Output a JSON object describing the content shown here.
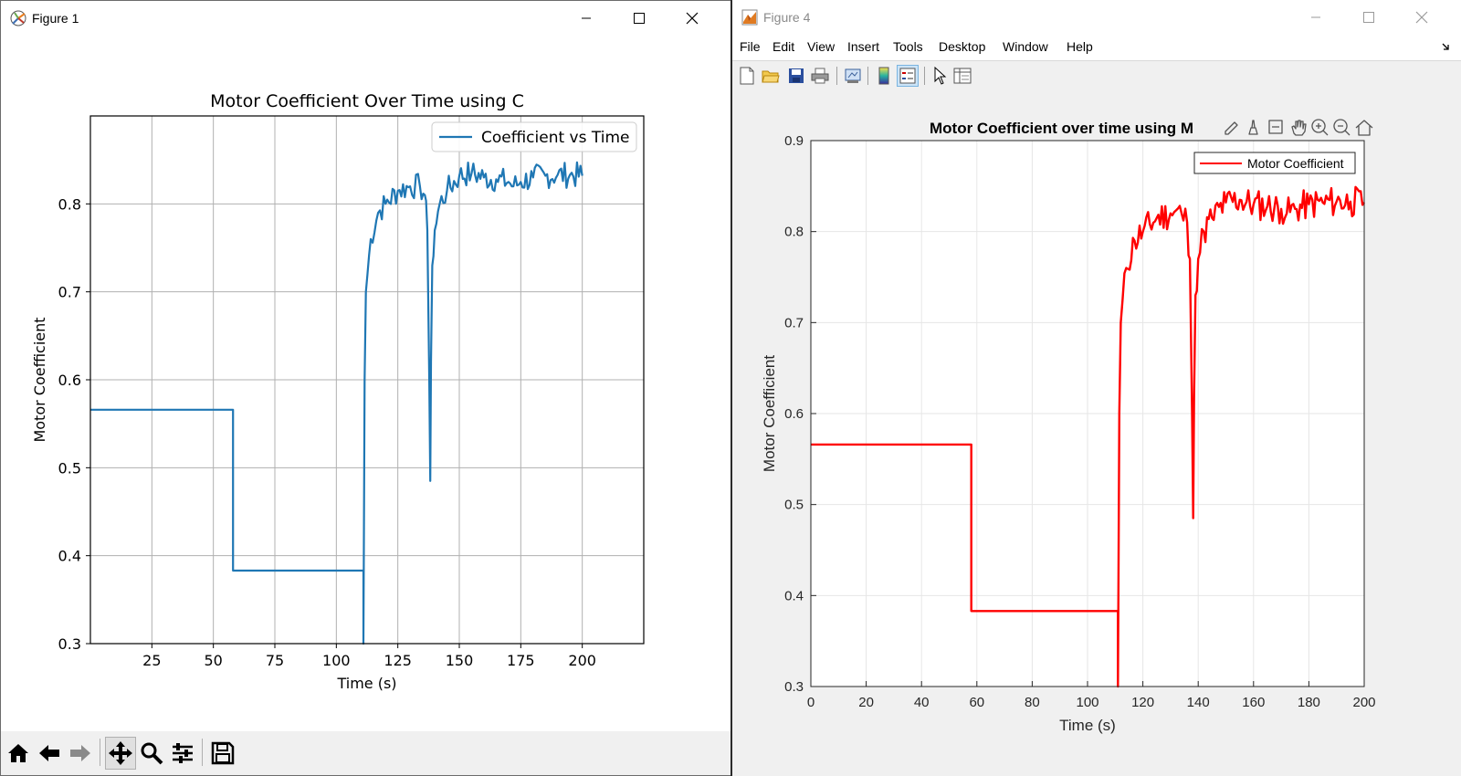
{
  "window1": {
    "title": "Figure 1",
    "chart_data": {
      "type": "line",
      "title": "Motor Coefficient Over Time using C",
      "xlabel": "Time (s)",
      "ylabel": "Motor Coefficient",
      "xlim": [
        0,
        225
      ],
      "ylim": [
        0.3,
        0.9
      ],
      "xticks": [
        25,
        50,
        75,
        100,
        125,
        150,
        175,
        200
      ],
      "yticks": [
        0.3,
        0.4,
        0.5,
        0.6,
        0.7,
        0.8
      ],
      "grid": true,
      "legend_position": "upper-right",
      "series": [
        {
          "name": "Coefficient vs Time",
          "color": "#1f77b4",
          "x": [
            0,
            58,
            58,
            111,
            111,
            111.5,
            112,
            114,
            117,
            120,
            125,
            130,
            134,
            136,
            137,
            137.8,
            138.2,
            138.5,
            139,
            140,
            142,
            145,
            150,
            155,
            160,
            165,
            170,
            172,
            175,
            180,
            185,
            190,
            195,
            200
          ],
          "y": [
            0.566,
            0.566,
            0.383,
            0.383,
            0.3,
            0.6,
            0.7,
            0.76,
            0.79,
            0.8,
            0.815,
            0.82,
            0.82,
            0.81,
            0.77,
            0.6,
            0.485,
            0.62,
            0.73,
            0.77,
            0.8,
            0.815,
            0.832,
            0.835,
            0.83,
            0.828,
            0.825,
            0.82,
            0.825,
            0.83,
            0.832,
            0.833,
            0.833,
            0.832
          ]
        }
      ]
    },
    "toolbar_buttons": [
      "home-icon",
      "back-icon",
      "forward-icon",
      "pan-icon",
      "zoom-icon",
      "configure-icon",
      "save-icon"
    ]
  },
  "window2": {
    "title": "Figure 4",
    "menu": [
      "File",
      "Edit",
      "View",
      "Insert",
      "Tools",
      "Desktop",
      "Window",
      "Help"
    ],
    "chart_data": {
      "type": "line",
      "title": "Motor Coefficient over time using M",
      "xlabel": "Time (s)",
      "ylabel": "Motor Coefficient",
      "xlim": [
        0,
        200
      ],
      "ylim": [
        0.3,
        0.9
      ],
      "xticks": [
        0,
        20,
        40,
        60,
        80,
        100,
        120,
        140,
        160,
        180,
        200
      ],
      "yticks": [
        0.3,
        0.4,
        0.5,
        0.6,
        0.7,
        0.8,
        0.9
      ],
      "grid": true,
      "legend_position": "upper-right",
      "series": [
        {
          "name": "Motor Coefficient",
          "color": "#ff0000",
          "x": [
            0,
            58,
            58,
            111,
            111,
            111.5,
            112,
            114,
            117,
            120,
            125,
            130,
            134,
            136,
            137,
            137.8,
            138.2,
            138.5,
            139,
            140,
            142,
            145,
            150,
            155,
            160,
            165,
            170,
            172,
            175,
            180,
            185,
            190,
            195,
            200
          ],
          "y": [
            0.566,
            0.566,
            0.383,
            0.383,
            0.3,
            0.6,
            0.7,
            0.76,
            0.79,
            0.8,
            0.815,
            0.82,
            0.82,
            0.81,
            0.77,
            0.6,
            0.485,
            0.62,
            0.73,
            0.77,
            0.8,
            0.815,
            0.832,
            0.835,
            0.83,
            0.828,
            0.825,
            0.82,
            0.825,
            0.83,
            0.832,
            0.833,
            0.833,
            0.832
          ]
        }
      ]
    }
  },
  "colors": {
    "mpl_line": "#1f77b4",
    "matlab_line": "#ff0000",
    "grid_mpl": "#b0b0b0",
    "grid_matlab": "#e6e6e6"
  }
}
